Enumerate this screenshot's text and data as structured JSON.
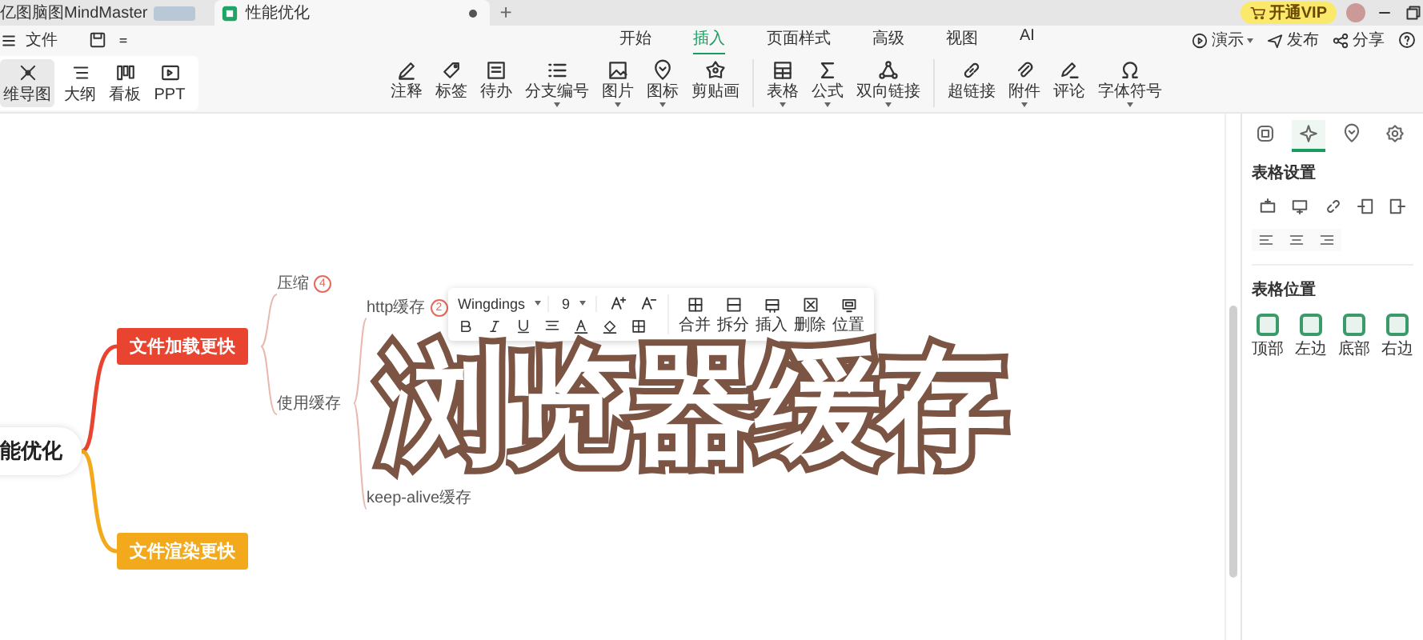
{
  "title_bar": {
    "tabs": [
      {
        "label": "亿图脑图MindMaster",
        "selected": false,
        "modified": false
      },
      {
        "label": "性能优化",
        "selected": true,
        "modified": true
      }
    ],
    "new_tab": "+",
    "vip_button": "开通VIP"
  },
  "menu_bar": {
    "file": "文件",
    "tabs": [
      {
        "label": "开始",
        "selected": false
      },
      {
        "label": "插入",
        "selected": true
      },
      {
        "label": "页面样式",
        "selected": false
      },
      {
        "label": "高级",
        "selected": false
      },
      {
        "label": "视图",
        "selected": false
      },
      {
        "label": "AI",
        "selected": false
      }
    ],
    "actions": [
      {
        "label": "演示",
        "dropdown": true
      },
      {
        "label": "发布",
        "dropdown": false
      },
      {
        "label": "分享",
        "dropdown": false
      }
    ]
  },
  "ribbon": {
    "view_modes": [
      {
        "label": "维导图",
        "selected": true
      },
      {
        "label": "大纲",
        "selected": false
      },
      {
        "label": "看板",
        "selected": false
      },
      {
        "label": "PPT",
        "selected": false
      }
    ],
    "tools": [
      {
        "label": "注释",
        "dropdown": false
      },
      {
        "label": "标签",
        "dropdown": false
      },
      {
        "label": "待办",
        "dropdown": false
      },
      {
        "label": "分支编号",
        "dropdown": true
      },
      {
        "label": "图片",
        "dropdown": true
      },
      {
        "label": "图标",
        "dropdown": true
      },
      {
        "label": "剪贴画",
        "dropdown": false
      },
      {
        "label": "表格",
        "dropdown": true
      },
      {
        "label": "公式",
        "dropdown": true
      },
      {
        "label": "双向链接",
        "dropdown": true
      },
      {
        "label": "超链接",
        "dropdown": false
      },
      {
        "label": "附件",
        "dropdown": true
      },
      {
        "label": "评论",
        "dropdown": false
      },
      {
        "label": "字体符号",
        "dropdown": true
      }
    ]
  },
  "mindmap": {
    "root": "能优化",
    "branches": [
      {
        "label": "文件加载更快",
        "color": "#e8442f",
        "children": [
          {
            "label": "压缩",
            "badge": "4"
          },
          {
            "label": "使用缓存",
            "children": [
              {
                "label": "http缓存",
                "badge": "2"
              },
              {
                "label": "keep-alive缓存"
              }
            ]
          }
        ]
      },
      {
        "label": "文件渲染更快",
        "color": "#f2aa1c"
      }
    ]
  },
  "text_toolbar": {
    "font": "Wingdings",
    "size": "9",
    "table_actions": [
      "合并",
      "拆分",
      "插入",
      "删除",
      "位置"
    ]
  },
  "caption": "浏览器缓存",
  "side_panel": {
    "tabs": [
      {
        "selected": false
      },
      {
        "selected": true
      },
      {
        "selected": false
      },
      {
        "selected": false
      }
    ],
    "table_settings": "表格设置",
    "table_position": {
      "title": "表格位置",
      "options": [
        "顶部",
        "左边",
        "底部",
        "右边"
      ]
    }
  }
}
